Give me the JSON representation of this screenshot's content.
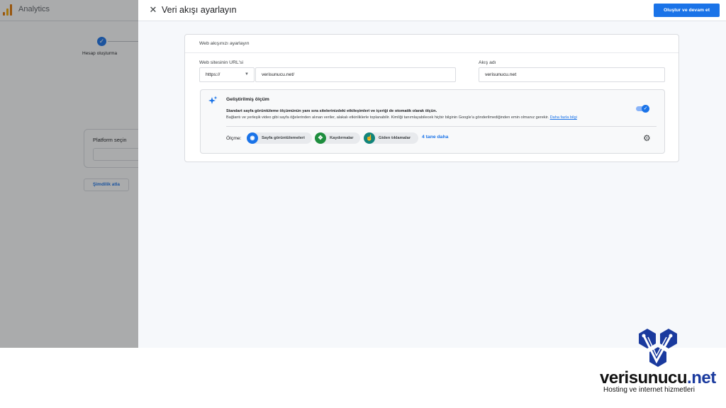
{
  "background": {
    "app_name": "Analytics",
    "step_label": "Hesap oluşturma",
    "platform_title": "Platform seçin",
    "skip_button": "Şimdilik atla"
  },
  "panel": {
    "title": "Veri akışı ayarlayın",
    "primary_button": "Oluştur ve devam et",
    "card_title": "Web akışınızı ayarlayın",
    "url_label": "Web sitesinin URL'si",
    "protocol_value": "https://",
    "url_value": "verisunucu.net/",
    "stream_label": "Akış adı",
    "stream_value": "verisunucu.net",
    "enhanced": {
      "title": "Geliştirilmiş ölçüm",
      "desc1": "Standart sayfa görüntüleme ölçümünün yanı sıra sitelerinizdeki etkileşimleri ve içeriği de otomatik olarak ölçün.",
      "desc2": "Bağlantı ve yerleşik video gibi sayfa öğelerinden alınan veriler, alakalı etkinliklerle toplanabilir. Kimliği tanımlayabilecek hiçbir bilginin Google'a gönderilmediğinden emin olmanız gerekir.",
      "link": "Daha fazla bilgi",
      "toggle_on": true,
      "measuring_label": "Ölçme:",
      "chips": [
        {
          "label": "Sayfa görüntülemeleri",
          "icon": "eye-icon",
          "color": "#1a73e8"
        },
        {
          "label": "Kaydırmalar",
          "icon": "arrows-icon",
          "color": "#1e8e3e"
        },
        {
          "label": "Giden tıklamalar",
          "icon": "click-icon",
          "color": "#12857b"
        }
      ],
      "more": "4 tane daha"
    }
  },
  "brand": {
    "name": "verisunucu",
    "tld": ".net",
    "tagline": "Hosting ve internet hizmetleri"
  }
}
